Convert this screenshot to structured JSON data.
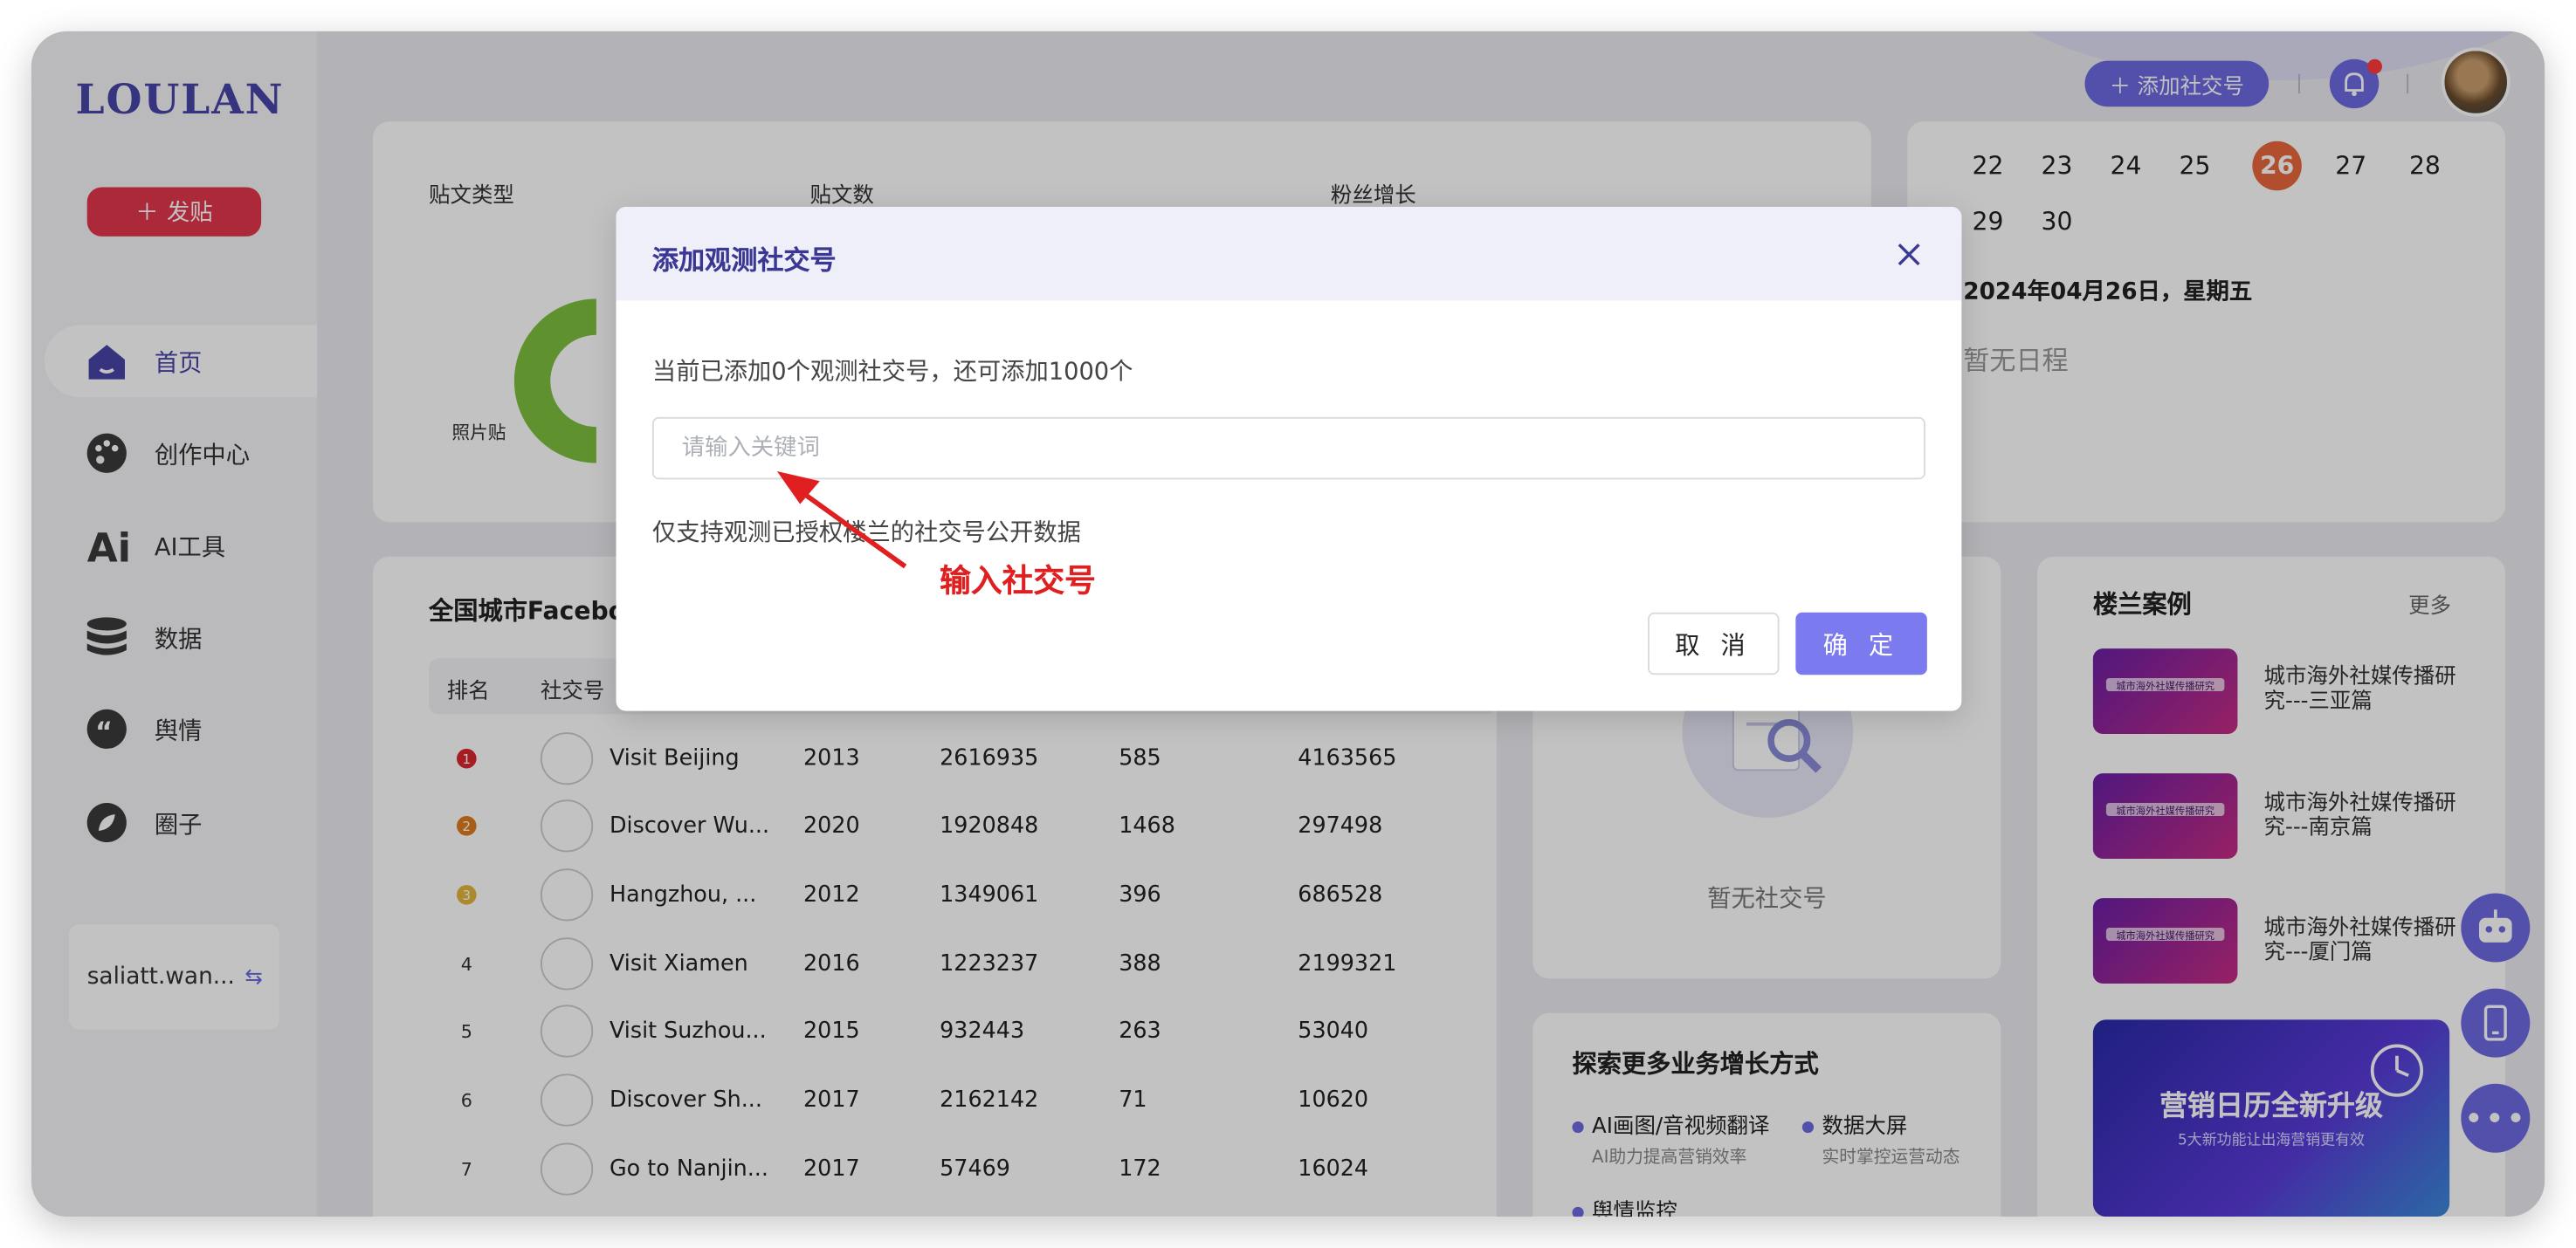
{
  "sidebar": {
    "logo": "LOULAN",
    "post_button": "发贴",
    "items": [
      {
        "label": "首页",
        "icon": "home-icon"
      },
      {
        "label": "创作中心",
        "icon": "palette-icon"
      },
      {
        "label": "AI工具",
        "icon": "ai-icon"
      },
      {
        "label": "数据",
        "icon": "database-icon"
      },
      {
        "label": "舆情",
        "icon": "quote-icon"
      },
      {
        "label": "圈子",
        "icon": "leaf-icon"
      }
    ],
    "account": "saliatt.wan..."
  },
  "topbar": {
    "add_account_button": "添加社交号"
  },
  "overview": {
    "col1": "贴文类型",
    "col2": "贴文数",
    "col3": "粉丝增长",
    "pie_label": "照片贴"
  },
  "calendar": {
    "row1": [
      "22",
      "23",
      "24",
      "25",
      "26",
      "27",
      "28"
    ],
    "row2": [
      "29",
      "30"
    ],
    "today": "26",
    "selected_date": "2024年04月26日，星期五",
    "empty_text": "暂无日程"
  },
  "ranking": {
    "title": "全国城市Facebo",
    "col_rank": "排名",
    "col_account": "社交号",
    "rows": [
      {
        "rank": "1",
        "name": "Visit Beijing",
        "year": "2013",
        "v1": "2616935",
        "v2": "585",
        "v3": "4163565"
      },
      {
        "rank": "2",
        "name": "Discover Wu...",
        "year": "2020",
        "v1": "1920848",
        "v2": "1468",
        "v3": "297498"
      },
      {
        "rank": "3",
        "name": "Hangzhou, ...",
        "year": "2012",
        "v1": "1349061",
        "v2": "396",
        "v3": "686528"
      },
      {
        "rank": "4",
        "name": "Visit Xiamen",
        "year": "2016",
        "v1": "1223237",
        "v2": "388",
        "v3": "2199321"
      },
      {
        "rank": "5",
        "name": "Visit Suzhou...",
        "year": "2015",
        "v1": "932443",
        "v2": "263",
        "v3": "53040"
      },
      {
        "rank": "6",
        "name": "Discover Sh...",
        "year": "2017",
        "v1": "2162142",
        "v2": "71",
        "v3": "10620"
      },
      {
        "rank": "7",
        "name": "Go to Nanjin...",
        "year": "2017",
        "v1": "57469",
        "v2": "172",
        "v3": "16024"
      }
    ]
  },
  "watch_panel": {
    "empty_text": "暂无社交号"
  },
  "explore": {
    "title": "探索更多业务增长方式",
    "items": [
      {
        "label": "AI画图/音视频翻译",
        "desc": "AI助力提高营销效率"
      },
      {
        "label": "数据大屏",
        "desc": "实时掌控运营动态"
      },
      {
        "label": "舆情监控",
        "desc": ""
      }
    ]
  },
  "cases": {
    "title": "楼兰案例",
    "more": "更多",
    "thumb_text": "城市海外社媒传播研究",
    "items": [
      {
        "text": "城市海外社媒传播研究---三亚篇"
      },
      {
        "text": "城市海外社媒传播研究---南京篇"
      },
      {
        "text": "城市海外社媒传播研究---厦门篇"
      }
    ],
    "banner_title": "营销日历全新升级",
    "banner_sub": "5大新功能让出海营销更有效"
  },
  "modal": {
    "title": "添加观测社交号",
    "info": "当前已添加0个观测社交号，还可添加1000个",
    "input_placeholder": "请输入关键词",
    "note": "仅支持观测已授权楼兰的社交号公开数据",
    "cancel": "取 消",
    "confirm": "确 定"
  },
  "annotation": {
    "text": "输入社交号",
    "color": "#e02020"
  }
}
